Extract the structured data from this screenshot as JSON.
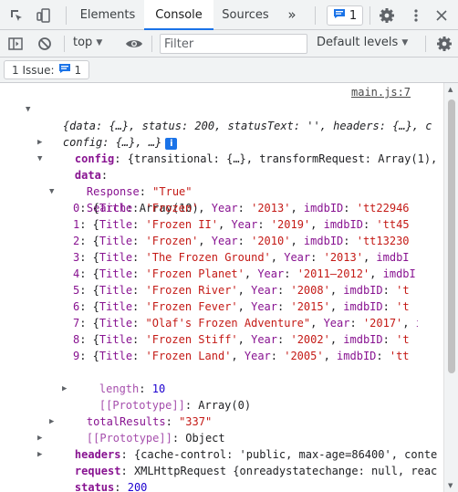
{
  "tabs": {
    "elements": "Elements",
    "console": "Console",
    "sources": "Sources",
    "more": "»"
  },
  "messages_count": "1",
  "toolbar": {
    "context": "top",
    "filter_placeholder": "Filter",
    "levels": "Default levels"
  },
  "issues": {
    "label": "1 Issue:",
    "count": "1"
  },
  "log": {
    "source": "main.js:7",
    "summary_1": "{data: {…}, status: 200, statusText: '', headers: {…}, c",
    "summary_2": "config: {…}, …}",
    "config_key": "config",
    "config_val": "{transitional: {…}, transformRequest: Array(1),",
    "data_key": "data",
    "response_key": "Response",
    "response_val": "\"True\"",
    "search_key": "Search",
    "search_val": "Array(10)",
    "items": [
      {
        "i": "0",
        "title": "'Frozen'",
        "year": "'2013'",
        "id": "'tt22946"
      },
      {
        "i": "1",
        "title": "'Frozen II'",
        "year": "'2019'",
        "id": "'tt45"
      },
      {
        "i": "2",
        "title": "'Frozen'",
        "year": "'2010'",
        "id": "'tt13230"
      },
      {
        "i": "3",
        "title": "'The Frozen Ground'",
        "year": "'2013'",
        "id": ""
      },
      {
        "i": "4",
        "title": "'Frozen Planet'",
        "year": "'2011–2012'",
        "id": ""
      },
      {
        "i": "5",
        "title": "'Frozen River'",
        "year": "'2008'",
        "id": "'t"
      },
      {
        "i": "6",
        "title": "'Frozen Fever'",
        "year": "'2015'",
        "id": "'t"
      },
      {
        "i": "7",
        "title": "\"Olaf's Frozen Adventure\"",
        "year": "'2017'",
        "id": ""
      },
      {
        "i": "8",
        "title": "'Frozen Stiff'",
        "year": "'2002'",
        "id": "'t"
      },
      {
        "i": "9",
        "title": "'Frozen Land'",
        "year": "'2005'",
        "id": "'tt"
      }
    ],
    "length_key": "length",
    "length_val": "10",
    "proto_key": "[[Prototype]]",
    "proto_array": "Array(0)",
    "total_key": "totalResults",
    "total_val": "\"337\"",
    "proto_object": "Object",
    "headers_key": "headers",
    "headers_val": "{cache-control: 'public, max-age=86400', conte",
    "request_key": "request",
    "request_val": "XMLHttpRequest {onreadystatechange: null, reac",
    "status_key": "status",
    "status_val": "200",
    "statustext_key": "statusText",
    "statustext_val": "\"\""
  },
  "colors": {
    "accent": "#1a73e8",
    "key": "#881391",
    "string": "#c41a16",
    "number": "#1c00cf"
  }
}
